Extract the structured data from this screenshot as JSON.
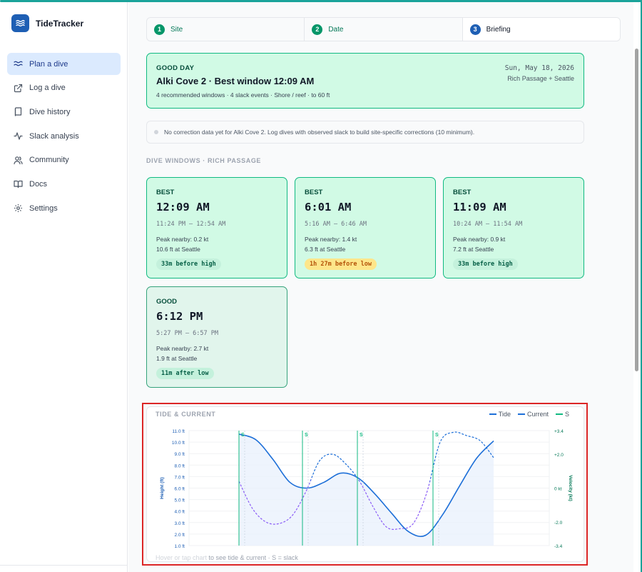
{
  "app": {
    "name": "TideTracker"
  },
  "sidebar": {
    "items": [
      {
        "label": "Plan a dive",
        "icon": "waves-icon",
        "active": true
      },
      {
        "label": "Log a dive",
        "icon": "external-link-icon",
        "active": false
      },
      {
        "label": "Dive history",
        "icon": "book-icon",
        "active": false
      },
      {
        "label": "Slack analysis",
        "icon": "activity-icon",
        "active": false
      },
      {
        "label": "Community",
        "icon": "users-icon",
        "active": false
      },
      {
        "label": "Docs",
        "icon": "open-book-icon",
        "active": false
      },
      {
        "label": "Settings",
        "icon": "gear-icon",
        "active": false
      }
    ]
  },
  "stepper": {
    "steps": [
      {
        "num": "1",
        "label": "Site"
      },
      {
        "num": "2",
        "label": "Date"
      },
      {
        "num": "3",
        "label": "Briefing"
      }
    ]
  },
  "summary": {
    "rating": "GOOD DAY",
    "title": "Alki Cove 2 · Best window 12:09 AM",
    "meta": "4 recommended windows · 4 slack events · Shore / reef · to 60 ft",
    "date": "Sun, May 18, 2026",
    "location": "Rich Passage + Seattle"
  },
  "notice": {
    "text": "No correction data yet for Alki Cove 2. Log dives with observed slack to build site-specific corrections (10 minimum)."
  },
  "windows_section": {
    "label": "DIVE WINDOWS · RICH PASSAGE"
  },
  "windows": [
    {
      "rating": "BEST",
      "time": "12:09 AM",
      "range": "11:24 PM – 12:54 AM",
      "peak": "Peak nearby: 0.2 kt",
      "height": "10.6 ft at Seattle",
      "badge": "33m before high",
      "badge_tone": "green"
    },
    {
      "rating": "BEST",
      "time": "6:01 AM",
      "range": "5:16 AM – 6:46 AM",
      "peak": "Peak nearby: 1.4 kt",
      "height": "6.3 ft at Seattle",
      "badge": "1h 27m before low",
      "badge_tone": "amber"
    },
    {
      "rating": "BEST",
      "time": "11:09 AM",
      "range": "10:24 AM – 11:54 AM",
      "peak": "Peak nearby: 0.9 kt",
      "height": "7.2 ft at Seattle",
      "badge": "33m before high",
      "badge_tone": "green"
    },
    {
      "rating": "GOOD",
      "time": "6:12 PM",
      "range": "5:27 PM – 6:57 PM",
      "peak": "Peak nearby: 2.7 kt",
      "height": "1.9 ft at Seattle",
      "badge": "11m after low",
      "badge_tone": "green"
    }
  ],
  "chart_panel": {
    "title": "TIDE & CURRENT",
    "legend": [
      {
        "label": "Tide",
        "color": "#1d6fd8"
      },
      {
        "label": "Current",
        "color": "#1d6fd8"
      },
      {
        "label": "S",
        "color": "#10b981"
      }
    ],
    "hint_link": "Hover or tap chart",
    "hint_rest": " to see tide & current · S = slack"
  },
  "colors": {
    "accent": "#1e5fb4",
    "good": "#10b981",
    "tide": "#1d6fd8",
    "current": "#8b5cf6"
  },
  "chart_data": {
    "type": "line",
    "x": [
      0,
      1,
      2,
      3,
      4,
      5,
      6,
      7,
      8,
      9,
      10,
      11,
      12,
      13,
      14,
      15,
      16,
      17,
      18,
      19,
      20,
      21,
      22,
      23,
      24
    ],
    "series": [
      {
        "name": "Tide",
        "axis": "left",
        "unit": "ft",
        "values": [
          10.7,
          10.2,
          8.5,
          6.5,
          6.0,
          6.5,
          7.3,
          6.9,
          5.5,
          3.8,
          2.2,
          1.9,
          3.7,
          6.2,
          8.6,
          10.1
        ]
      },
      {
        "name": "Current",
        "axis": "right",
        "unit": "kt",
        "values": [
          0.4,
          -1.2,
          -2.0,
          -2.1,
          -1.6,
          -0.2,
          1.6,
          2.0,
          1.4,
          0.4,
          -1.1,
          -2.3,
          -2.4,
          -2.1,
          -0.3,
          2.7,
          3.3,
          3.1,
          2.8,
          1.8
        ]
      },
      {
        "name": "S",
        "slack_labels": [
          "S",
          "S",
          "S",
          "S"
        ]
      }
    ],
    "y_left_ticks": [
      "11.0 ft",
      "10.0 ft",
      "9.0 ft",
      "8.0 ft",
      "7.0 ft",
      "6.0 ft",
      "5.0 ft",
      "4.0 ft",
      "3.0 ft",
      "2.0 ft",
      "1.0 ft"
    ],
    "y_right_ticks": [
      "+3.4",
      "+2.0",
      "0 kt",
      "-2.0",
      "-3.4"
    ],
    "ylabel_left": "Height (ft)",
    "ylabel_right": "Velocity (kt)",
    "ylim_left": [
      1,
      11
    ],
    "ylim_right": [
      -3.4,
      3.4
    ],
    "grid": true,
    "legend_position": "top-right"
  }
}
